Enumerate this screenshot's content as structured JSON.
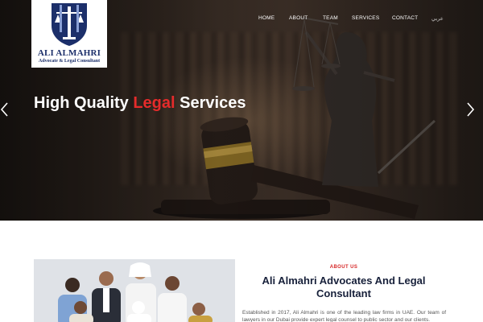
{
  "brand": {
    "name": "ALI ALMAHRI",
    "subtitle": "Advocate & Legal Consultant",
    "colors": {
      "navy": "#1c2f6a",
      "accent_red": "#e52b2b"
    }
  },
  "nav": {
    "items": [
      {
        "label": "HOME"
      },
      {
        "label": "ABOUT"
      },
      {
        "label": "TEAM"
      },
      {
        "label": "SERVICES"
      },
      {
        "label": "CONTACT"
      },
      {
        "label": "عربي"
      }
    ]
  },
  "hero": {
    "title_before": "High Quality ",
    "title_accent": "Legal",
    "title_after": " Services",
    "prev_icon": "chevron-left-icon",
    "next_icon": "chevron-right-icon"
  },
  "about": {
    "label": "ABOUT US",
    "heading": "Ali Almahri Advocates And Legal Consultant",
    "body": "Established in 2017, Ali Almahri is one of the leading law firms in UAE. Our team of lawyers in our Dubai provide expert legal counsel to public sector and our clients."
  }
}
